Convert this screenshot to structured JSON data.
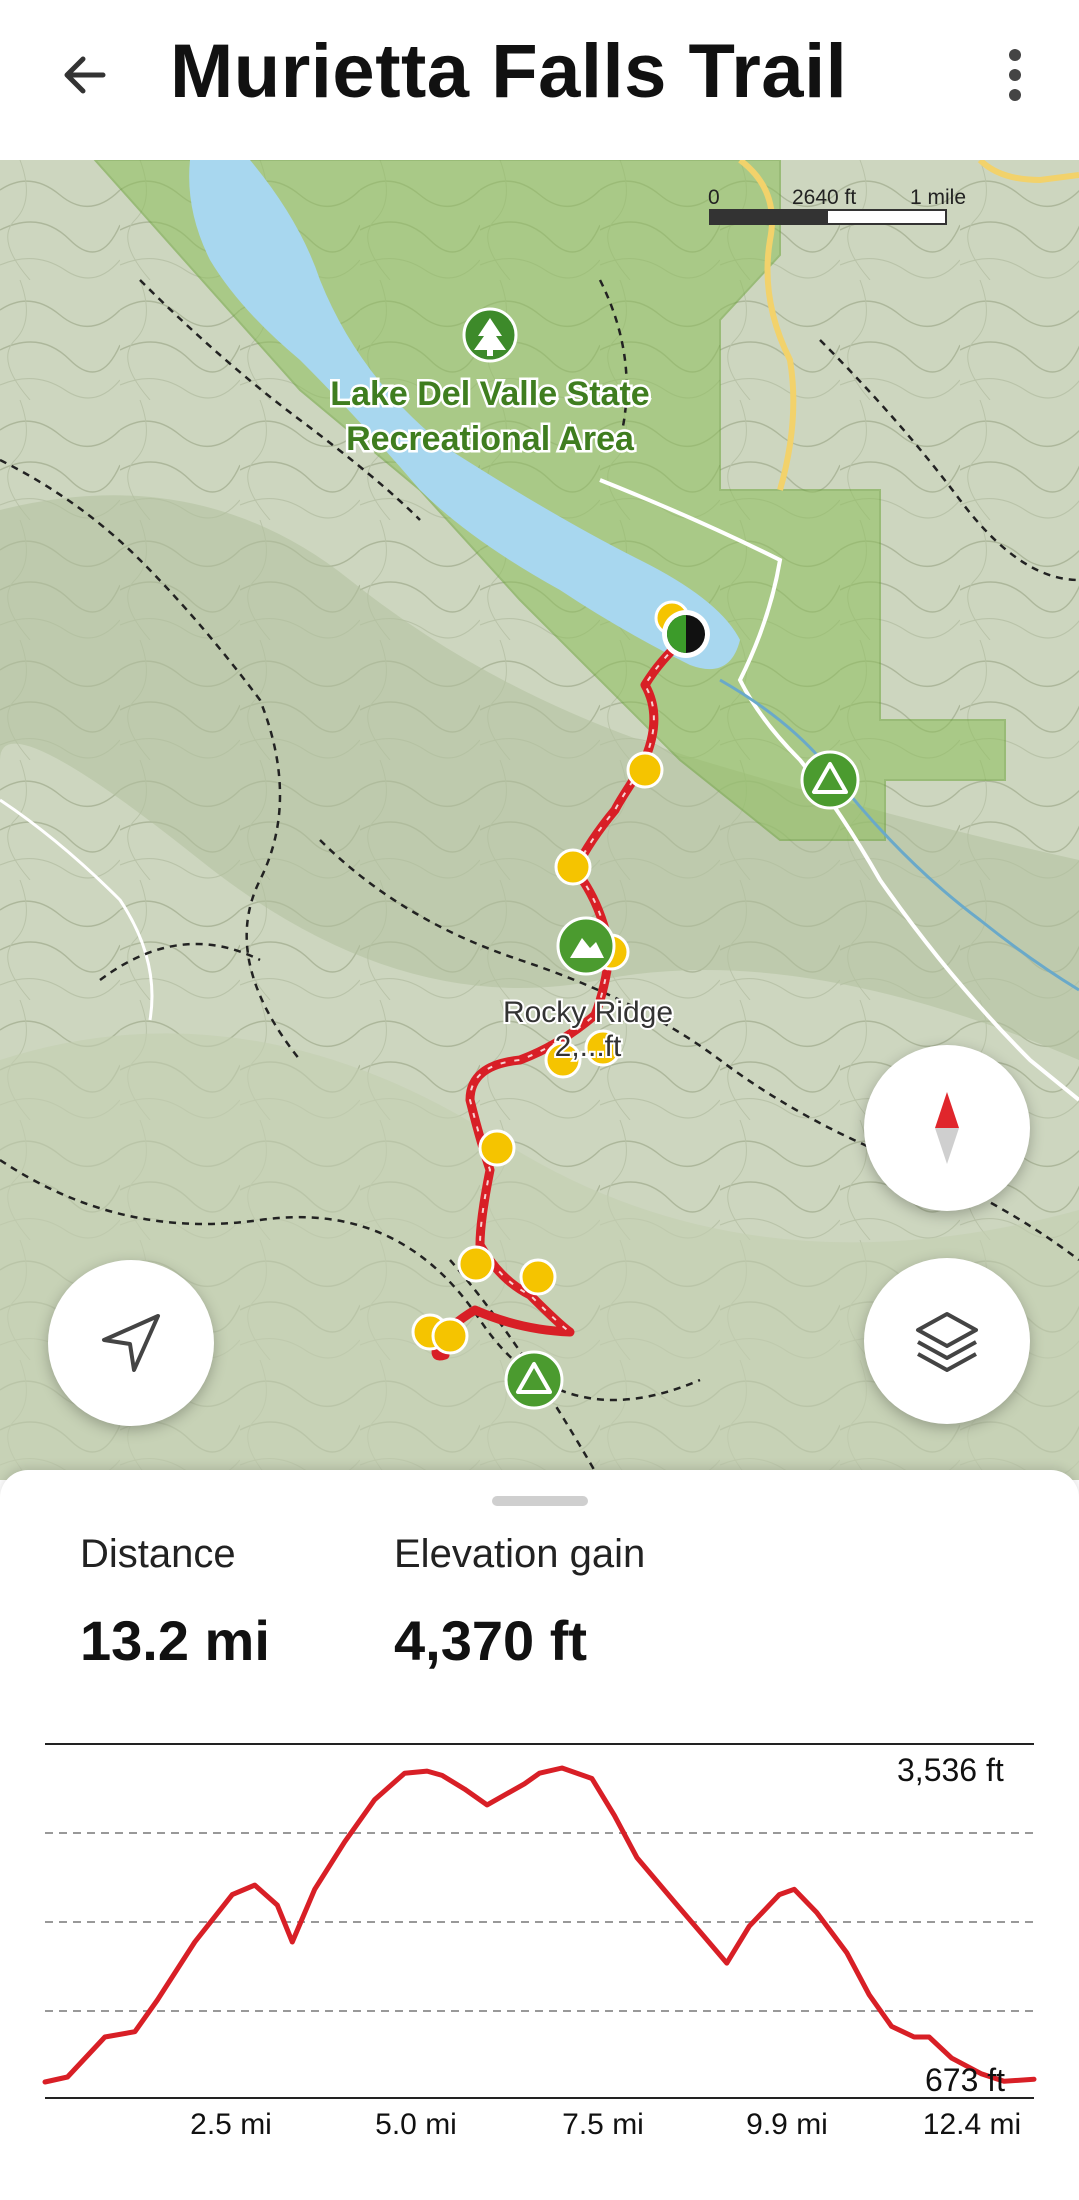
{
  "header": {
    "title": "Murietta Falls Trail",
    "back_icon": "arrow-left-icon",
    "menu_icon": "more-vertical-icon"
  },
  "map": {
    "scale_bar": {
      "zero": "0",
      "mid": "2640 ft",
      "end": "1 mile"
    },
    "park_label_line1": "Lake Del Valle State",
    "park_label_line2": "Recreational Area",
    "peak_label_line1": "Rocky Ridge",
    "peak_label_line2": "2,...ft",
    "colors": {
      "trail": "#d81f26",
      "waypoint": "#f5c400",
      "park": "#8dbf5a",
      "water": "#a8d7ef",
      "terrain": "#c9d3b9",
      "marker": "#4b9b2f"
    },
    "buttons": {
      "compass_icon": "compass-icon",
      "layers_icon": "layers-icon",
      "locate_icon": "navigation-arrow-icon"
    }
  },
  "stats": {
    "distance_label": "Distance",
    "distance_value": "13.2 mi",
    "elevation_label": "Elevation gain",
    "elevation_value": "4,370 ft"
  },
  "elevation_chart": {
    "max_label": "3,536 ft",
    "min_label": "673 ft",
    "x_ticks": [
      "2.5 mi",
      "5.0 mi",
      "7.5 mi",
      "9.9 mi",
      "12.4 mi"
    ]
  },
  "chart_data": {
    "type": "line",
    "title": "",
    "xlabel": "",
    "ylabel": "",
    "x_unit": "mi",
    "y_unit": "ft",
    "ylim": [
      673,
      3536
    ],
    "x": [
      0,
      0.3,
      0.8,
      1.2,
      1.5,
      2.0,
      2.5,
      2.8,
      3.1,
      3.3,
      3.6,
      4.0,
      4.4,
      4.8,
      5.1,
      5.3,
      5.6,
      5.9,
      6.4,
      6.6,
      6.9,
      7.3,
      7.6,
      7.9,
      8.4,
      8.8,
      9.1,
      9.4,
      9.8,
      10.0,
      10.3,
      10.7,
      11.0,
      11.3,
      11.6,
      11.8,
      12.1,
      12.5,
      12.8,
      13.2
    ],
    "series": [
      {
        "values": [
          673,
          720,
          1100,
          1150,
          1450,
          2000,
          2450,
          2540,
          2350,
          2000,
          2500,
          2950,
          3350,
          3600,
          3620,
          3580,
          3450,
          3300,
          3500,
          3600,
          3650,
          3550,
          3200,
          2800,
          2380,
          2050,
          1800,
          2150,
          2450,
          2500,
          2280,
          1900,
          1500,
          1200,
          1100,
          1100,
          900,
          750,
          680,
          700
        ]
      }
    ]
  }
}
